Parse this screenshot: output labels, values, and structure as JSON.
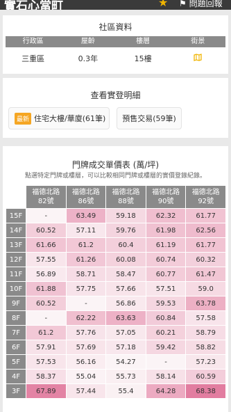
{
  "header": {
    "title": "實石心當町",
    "report_label": "問題回報"
  },
  "community": {
    "section_title": "社區資料",
    "columns": [
      "行政區",
      "屋齡",
      "樓層",
      "街景"
    ],
    "values": {
      "district": "三重區",
      "age": "0.3年",
      "floors": "15樓"
    },
    "map_icon_color": "#f0b400"
  },
  "records": {
    "section_title": "查看實登明細",
    "residential": {
      "badge": "最新",
      "label": "住宅大樓/華廈(61筆)"
    },
    "presale": {
      "label": "預售交易(59筆)"
    }
  },
  "price_table": {
    "title": "門牌成交單價表 (萬/坪)",
    "subtitle": "點選特定門牌或樓層，可以比較相同門牌或樓層的實價登錄紀錄。",
    "columns": [
      {
        "road": "福德北路",
        "number": "82號"
      },
      {
        "road": "福德北路",
        "number": "86號"
      },
      {
        "road": "福德北路",
        "number": "88號"
      },
      {
        "road": "福德北路",
        "number": "90號"
      },
      {
        "road": "福德北路",
        "number": "92號"
      }
    ],
    "rows": [
      {
        "floor": "15F",
        "cells": [
          "-",
          "63.49",
          "59.18",
          "62.32",
          "61.77"
        ]
      },
      {
        "floor": "14F",
        "cells": [
          "60.52",
          "57.11",
          "59.76",
          "61.98",
          "62.56"
        ]
      },
      {
        "floor": "13F",
        "cells": [
          "61.66",
          "61.2",
          "60.4",
          "61.19",
          "61.77"
        ]
      },
      {
        "floor": "12F",
        "cells": [
          "57.55",
          "61.26",
          "60.08",
          "60.74",
          "60.32"
        ]
      },
      {
        "floor": "11F",
        "cells": [
          "56.89",
          "58.71",
          "58.47",
          "60.77",
          "61.47"
        ]
      },
      {
        "floor": "10F",
        "cells": [
          "61.88",
          "57.75",
          "57.66",
          "57.51",
          "59.0"
        ]
      },
      {
        "floor": "9F",
        "cells": [
          "60.52",
          "-",
          "56.86",
          "59.53",
          "63.78"
        ]
      },
      {
        "floor": "8F",
        "cells": [
          "-",
          "62.22",
          "63.63",
          "60.84",
          "57.58"
        ]
      },
      {
        "floor": "7F",
        "cells": [
          "61.2",
          "57.76",
          "57.05",
          "60.21",
          "58.79"
        ]
      },
      {
        "floor": "6F",
        "cells": [
          "57.91",
          "57.69",
          "57.18",
          "59.42",
          "58.82"
        ]
      },
      {
        "floor": "5F",
        "cells": [
          "57.53",
          "56.16",
          "54.27",
          "-",
          "57.23"
        ]
      },
      {
        "floor": "4F",
        "cells": [
          "58.37",
          "55.04",
          "55.73",
          "58.14",
          "60.59"
        ]
      },
      {
        "floor": "3F",
        "cells": [
          "67.89",
          "57.44",
          "55.4",
          "64.28",
          "68.38"
        ]
      }
    ],
    "heat_colors": {
      "low": "#fbf4f6",
      "high": "#e27da0"
    }
  }
}
